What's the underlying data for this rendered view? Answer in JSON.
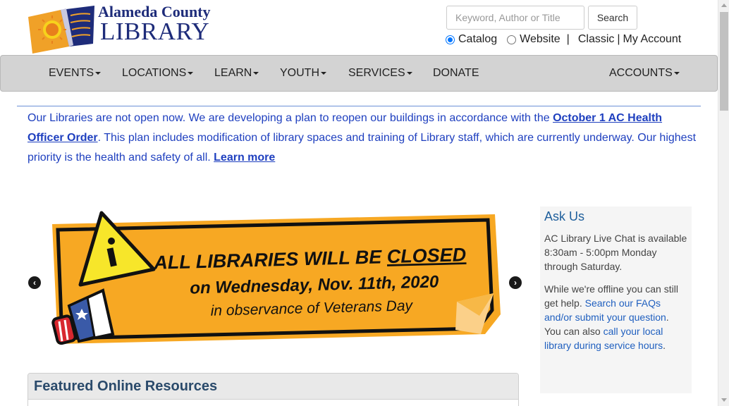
{
  "header": {
    "logo_line1": "Alameda County",
    "logo_line2": "LIBRARY",
    "search": {
      "placeholder": "Keyword, Author or Title",
      "button_label": "Search"
    },
    "scope": {
      "options": [
        "Catalog",
        "Website"
      ],
      "selected": "Catalog",
      "separator": "|",
      "classic_label": "Classic",
      "my_account_label": "My Account"
    }
  },
  "nav": {
    "items": [
      "EVENTS",
      "LOCATIONS",
      "LEARN",
      "YOUTH",
      "SERVICES",
      "DONATE"
    ],
    "right_item": "ACCOUNTS"
  },
  "alert": {
    "text_1": "Our Libraries are not open now. We are developing a plan to reopen our buildings in accordance with the ",
    "link_1": "October 1 AC Health Officer Order",
    "text_2": ". This plan includes modification of library spaces and training of Library staff, which are currently underway. Our highest priority is the health and safety of all. ",
    "link_2": "Learn more"
  },
  "banner": {
    "line1_a": "ALL LIBRARIES WILL BE ",
    "line1_b": "CLOSED",
    "line2": "on Wednesday, Nov. 11th, 2020",
    "line3": "in observance of Veterans Day",
    "colors": {
      "background": "#f7a823",
      "border": "#111111",
      "icon_yellow": "#f7e62a"
    }
  },
  "ask_us": {
    "title": "Ask Us",
    "p1": "AC Library Live Chat is available 8:30am - 5:00pm Monday through Saturday.",
    "p2_a": "While we're offline you can still get help. ",
    "p2_link1": "Search our FAQs and/or submit your question",
    "p2_b": ". You can also ",
    "p2_link2": "call your local library during service hours",
    "p2_c": "."
  },
  "featured": {
    "title": "Featured Online Resources"
  },
  "colors": {
    "brand_navy": "#1e2c7a",
    "nav_bg": "#d3d3d3",
    "alert_text": "#1e3fbf",
    "ask_title": "#1f5f9c"
  }
}
